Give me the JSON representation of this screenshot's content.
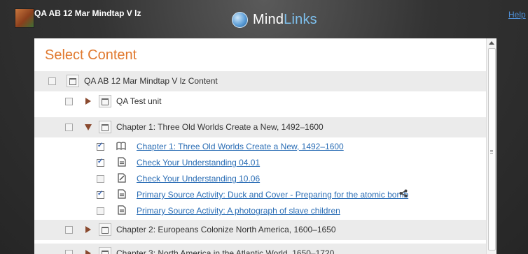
{
  "header": {
    "course_title": "QA AB 12 Mar Mindtap V lz",
    "logo_text_main": "Mind",
    "logo_text_accent": "Links",
    "help_label": "Help"
  },
  "panel": {
    "title": "Select Content"
  },
  "tree": [
    {
      "label": "QA AB 12 Mar Mindtap V lz Content",
      "kind": "root",
      "checked": false
    },
    {
      "label": "QA Test unit",
      "kind": "folder",
      "expanded": false,
      "checked": false
    },
    {
      "label": "Chapter 1: Three Old Worlds Create a New, 1492–1600",
      "kind": "folder",
      "expanded": true,
      "checked": false
    },
    {
      "label": "Chapter 1: Three Old Worlds Create a New, 1492–1600",
      "kind": "item",
      "icon": "book-icon",
      "checked": true
    },
    {
      "label": "Check Your Understanding 04.01",
      "kind": "item",
      "icon": "document-icon",
      "checked": true
    },
    {
      "label": "Check Your Understanding 10.06",
      "kind": "item",
      "icon": "edit-document-icon",
      "checked": false
    },
    {
      "label": "Primary Source Activity: Duck and Cover - Preparing for the atomic bomb",
      "kind": "item",
      "icon": "document-icon",
      "checked": true,
      "shared": true
    },
    {
      "label": "Primary Source Activity: A photograph of slave children",
      "kind": "item",
      "icon": "document-icon",
      "checked": false
    },
    {
      "label": "Chapter 2: Europeans Colonize North America, 1600–1650",
      "kind": "folder",
      "expanded": false,
      "checked": false
    },
    {
      "label": "Chapter 3: North America in the Atlantic World, 1650–1720",
      "kind": "folder",
      "expanded": false,
      "checked": false
    }
  ],
  "colors": {
    "title": "#e0782d",
    "link": "#2a6db5",
    "expander": "#8a4a2f"
  }
}
